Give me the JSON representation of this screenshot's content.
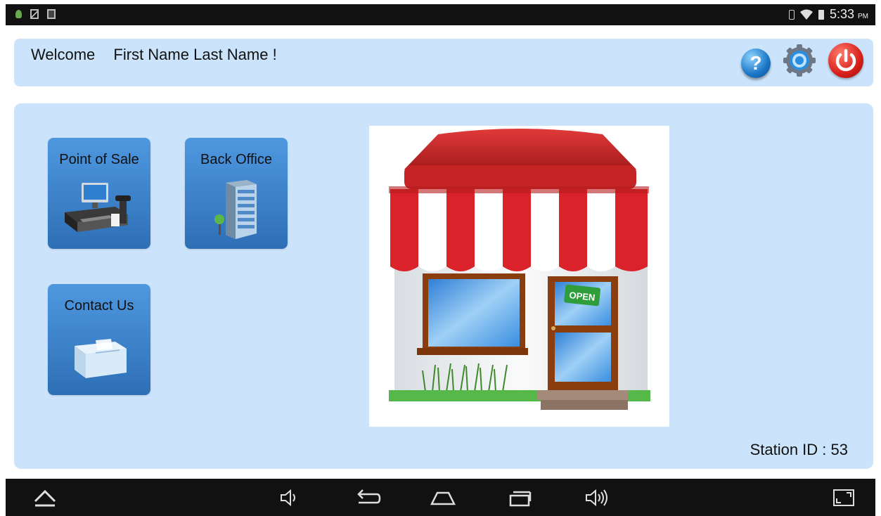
{
  "status_bar": {
    "time": "5:33",
    "ampm": "PM",
    "icons": [
      "android-icon",
      "image-icon",
      "picture-icon",
      "vibrate-icon",
      "wifi-icon",
      "battery-icon"
    ]
  },
  "header": {
    "welcome_label": "Welcome",
    "user_name": "First Name Last Name !",
    "icons": [
      "help-icon",
      "settings-gear-icon",
      "power-icon"
    ],
    "help_glyph": "?"
  },
  "tiles": [
    {
      "label": "Point of Sale",
      "icon": "cash-register-icon"
    },
    {
      "label": "Back Office",
      "icon": "office-building-icon"
    },
    {
      "label": "Contact Us",
      "icon": "mailbox-icon"
    }
  ],
  "store": {
    "sign_text": "OPEN",
    "illustration": "storefront-icon"
  },
  "station_id": "Station ID : 53",
  "nav_bar": {
    "icons": [
      "hide-keyboard-icon",
      "volume-down-icon",
      "back-icon",
      "home-icon",
      "recents-icon",
      "volume-up-icon",
      "fullscreen-icon"
    ]
  },
  "colors": {
    "panel_bg": "#cce4fb",
    "tile_top": "#4e98e0",
    "tile_bottom": "#2e6fb6",
    "awning_red": "#d9222a",
    "power_red": "#d8211b",
    "help_blue": "#1a76c6"
  }
}
